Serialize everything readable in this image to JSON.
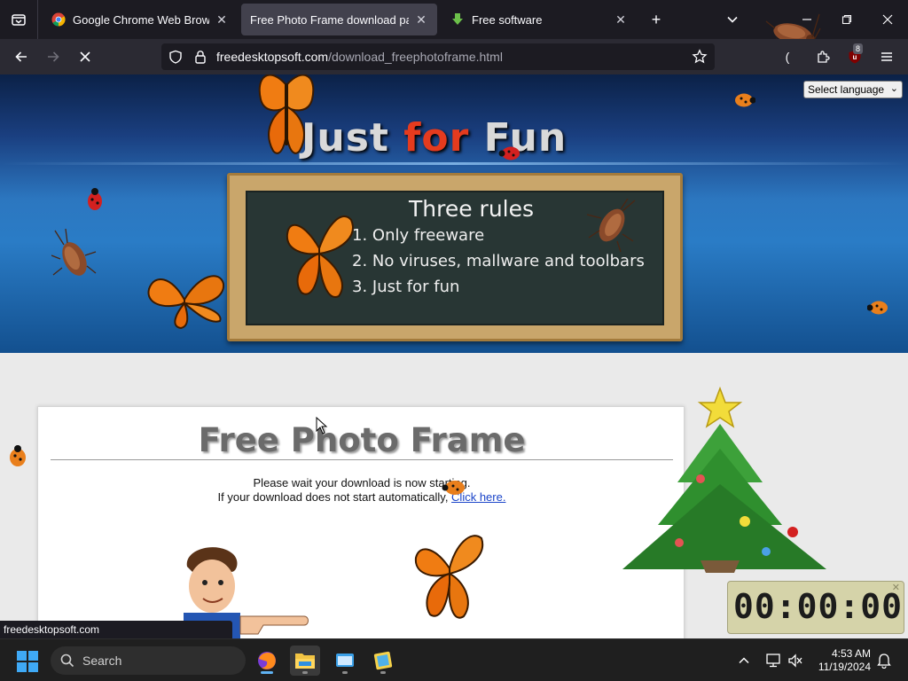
{
  "tabs": [
    {
      "title": "Google Chrome Web Browser",
      "favicon": "chrome-icon",
      "active": false
    },
    {
      "title": "Free Photo Frame download page.",
      "favicon": "none",
      "active": true
    },
    {
      "title": "Free software",
      "favicon": "green-download-arrow-icon",
      "active": false
    }
  ],
  "navbar": {
    "url_domain": "freedesktopsoft.com",
    "url_path": "/download_freephotoframe.html",
    "extension_badge": "8"
  },
  "page": {
    "language_select": "Select language",
    "site_title_part1": "Just ",
    "site_title_part2": "for",
    "site_title_part3": " Fun",
    "chalkboard_title": "Three rules",
    "rules": [
      "1. Only freeware",
      "2. No viruses, mallware and toolbars",
      "3. Just for fun"
    ],
    "heading": "Free Photo Frame",
    "wait_text": "Please wait your download is now starting.",
    "fallback_text": "If your download does not start automatically, ",
    "click_here": "Click here."
  },
  "status_bar": "freedesktopsoft.com",
  "clock_widget": "00:00:00",
  "taskbar": {
    "search_label": "Search",
    "time": "4:53 AM",
    "date": "11/19/2024"
  },
  "colors": {
    "browser_chrome": "#1c1b22",
    "active_tab": "#42414d",
    "link": "#1a44c9",
    "title_accent": "#e53b1e"
  }
}
